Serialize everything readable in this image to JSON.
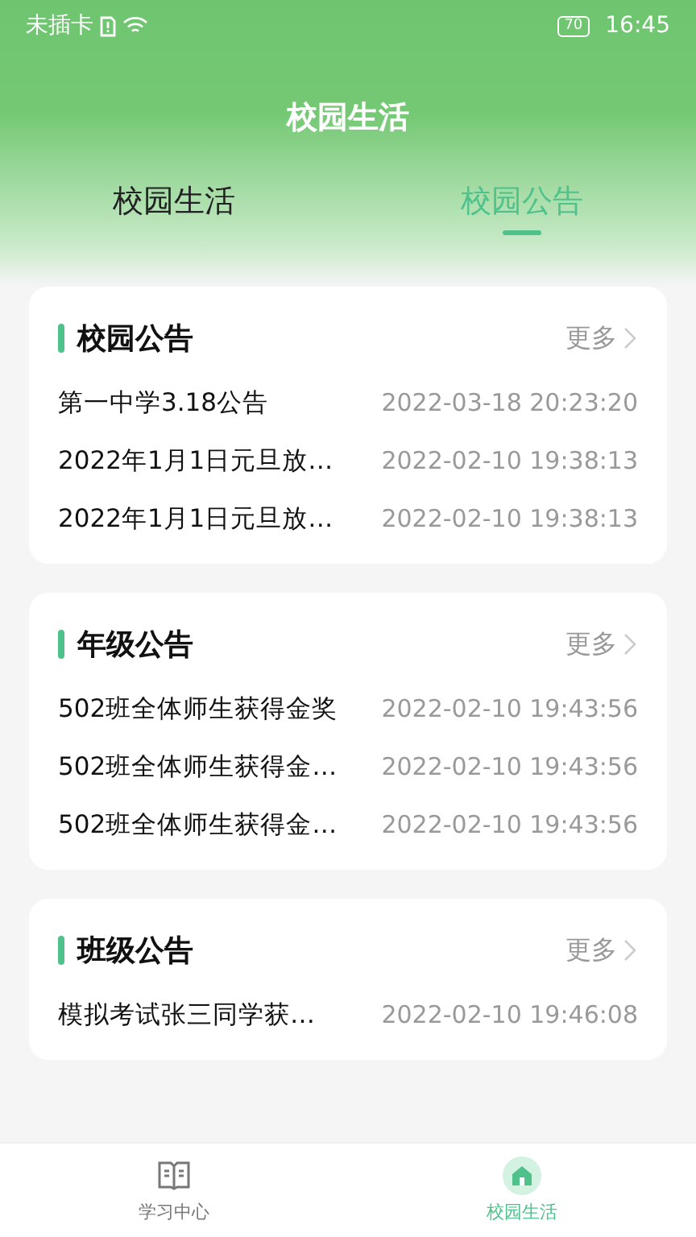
{
  "status_bar": {
    "carrier": "未插卡",
    "battery": "70",
    "time": "16:45"
  },
  "header": {
    "title": "校园生活"
  },
  "tabs": [
    {
      "label": "校园生活",
      "selected": false
    },
    {
      "label": "校园公告",
      "selected": true
    }
  ],
  "sections": [
    {
      "title": "校园公告",
      "more": "更多",
      "items": [
        {
          "title": "第一中学3.18公告",
          "time": "2022-03-18 20:23:20"
        },
        {
          "title": "2022年1月1日元旦放…",
          "time": "2022-02-10 19:38:13"
        },
        {
          "title": "2022年1月1日元旦放…",
          "time": "2022-02-10 19:38:13"
        }
      ]
    },
    {
      "title": "年级公告",
      "more": "更多",
      "items": [
        {
          "title": "502班全体师生获得金奖",
          "time": "2022-02-10 19:43:56"
        },
        {
          "title": "502班全体师生获得金…",
          "time": "2022-02-10 19:43:56"
        },
        {
          "title": "502班全体师生获得金…",
          "time": "2022-02-10 19:43:56"
        }
      ]
    },
    {
      "title": "班级公告",
      "more": "更多",
      "items": [
        {
          "title": "模拟考试张三同学获…",
          "time": "2022-02-10 19:46:08"
        }
      ]
    }
  ],
  "bottom_nav": [
    {
      "label": "学习中心",
      "kind": "book",
      "selected": false
    },
    {
      "label": "校园生活",
      "kind": "school",
      "selected": true
    }
  ]
}
